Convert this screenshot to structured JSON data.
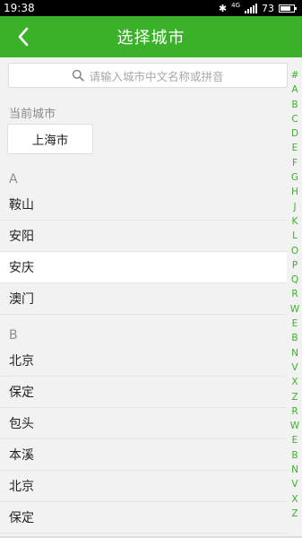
{
  "status_bar": {
    "time": "19:38",
    "network": "4G",
    "battery": "73",
    "battery_level": 0.73
  },
  "header": {
    "title": "选择城市",
    "back_icon": "chevron-left-icon"
  },
  "search": {
    "placeholder": "请输入城市中文名称或拼音",
    "icon": "search-icon"
  },
  "current_city": {
    "section_label": "当前城市",
    "city": "上海市"
  },
  "sections": [
    {
      "letter": "A",
      "cities": [
        "鞍山",
        "安阳",
        "安庆",
        "澳门"
      ]
    },
    {
      "letter": "B",
      "cities": [
        "北京",
        "保定",
        "包头",
        "本溪",
        "北京",
        "保定"
      ]
    }
  ],
  "selected_city": "安庆",
  "index_bar": [
    "#",
    "A",
    "B",
    "C",
    "D",
    "E",
    "F",
    "G",
    "H",
    "J",
    "K",
    "L",
    "O",
    "P",
    "Q",
    "R",
    "W",
    "E",
    "B",
    "N",
    "V",
    "X",
    "Z",
    "R",
    "W",
    "E",
    "B",
    "N",
    "V",
    "X",
    "Z"
  ],
  "colors": {
    "accent": "#3bb12a",
    "background": "#f2f2f2",
    "text": "#222222",
    "muted": "#8a8a8a"
  }
}
